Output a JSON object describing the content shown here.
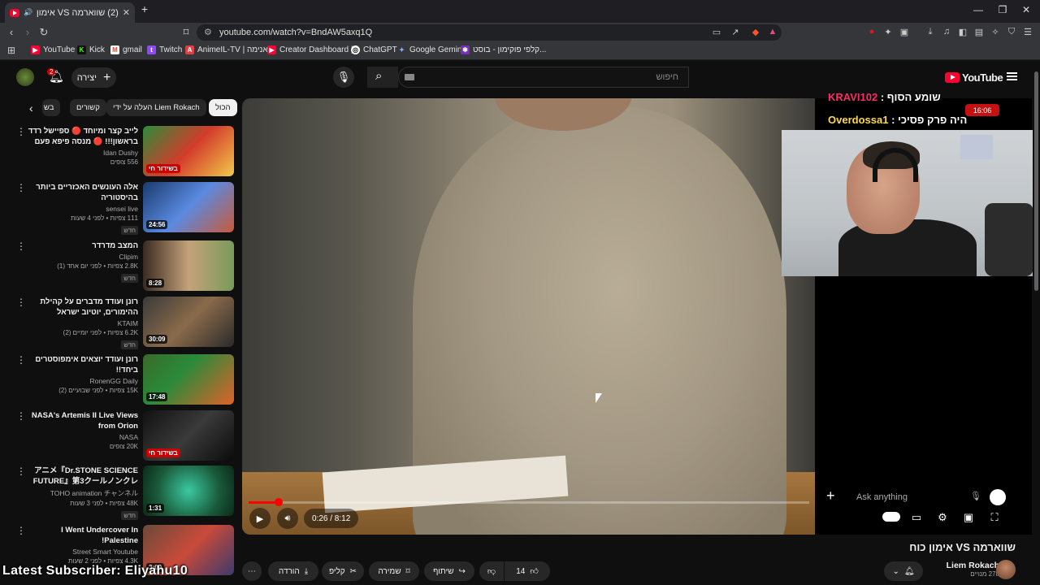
{
  "browser": {
    "tab_title": "(2) שווארמה VS אימון כוח - YouTube",
    "url": "youtube.com/watch?v=BndAW5axq1Q",
    "bookmarks": [
      {
        "label": "YouTube",
        "icon": "youtube-icon",
        "color": "#ff0033"
      },
      {
        "label": "Kick",
        "icon": "kick-icon",
        "color": "#53fc18"
      },
      {
        "label": "gmail",
        "icon": "gmail-icon",
        "color": "#ea4335"
      },
      {
        "label": "Twitch",
        "icon": "twitch-icon",
        "color": "#9146ff"
      },
      {
        "label": "AnimeIL-TV | אנימה...",
        "icon": "animeil-icon",
        "color": "#e04040"
      },
      {
        "label": "Creator Dashboard |...",
        "icon": "creator-dashboard-icon",
        "color": "#ff0033"
      },
      {
        "label": "ChatGPT",
        "icon": "chatgpt-icon",
        "color": "#cccccc"
      },
      {
        "label": "Google Gemini",
        "icon": "gemini-icon",
        "color": "#8ab4f8"
      },
      {
        "label": "קלפי פוקימון - בוסט...",
        "icon": "pokemon-icon",
        "color": "#7b2cbf"
      }
    ]
  },
  "youtube": {
    "search_placeholder": "חיפוש",
    "create_label": "יצירה",
    "notification_count": "2",
    "logo_text": "YouTube",
    "chips": [
      "הכול",
      "העלה על ידי Liem Rokach",
      "קשורים",
      "בש"
    ],
    "sidebar": [
      {
        "title": "לייב קצר ומיוחד 🔴 ספיישל רדד בראשון!!! 🔴 מנסה פיפא פעם ...",
        "channel": "Idan Dushy",
        "meta": "556 צופים",
        "badge": "בשידור חי",
        "live": true,
        "is_new": false
      },
      {
        "title": "אלה העונשים האכזריים ביותר בהיסטוריה",
        "channel": "sensei live",
        "meta": "111 צפיות • לפני 4 שעות",
        "badge": "24:56",
        "live": false,
        "is_new": true
      },
      {
        "title": "המצב מדרדר",
        "channel": "Clipim",
        "meta": "2.8K צפיות • לפני יום אחד (1)",
        "badge": "8:28",
        "live": false,
        "is_new": true
      },
      {
        "title": "רונן ועודד מדברים על קהילת ההימורים, יוטיוב ישראל וקהילת...",
        "channel": "KTAIM",
        "meta": "6.2K צפיות • לפני יומיים (2)",
        "badge": "30:09",
        "live": false,
        "is_new": true
      },
      {
        "title": "רונן ועודד יוצאים אימפוסטרים ביחד!!",
        "channel": "RonenGG Daily",
        "meta": "15K צפיות • לפני שבועיים (2)",
        "badge": "17:48",
        "live": false,
        "is_new": false
      },
      {
        "title": "NASA's Artemis II Live Views from Orion",
        "channel": "NASA",
        "meta": "20K צופים",
        "badge": "בשידור חי",
        "live": true,
        "is_new": false
      },
      {
        "title": "アニメ『Dr.STONE SCIENCE FUTURE』第3クールノンクレジ...",
        "channel": "TOHO animation チャンネル",
        "meta": "48K צפיות • לפני 3 שעות",
        "badge": "1:31",
        "live": false,
        "is_new": true
      },
      {
        "title": "I Went Undercover In Palestine!",
        "channel": "Street Smart Youtube",
        "meta": "4.3K צפיות • לפני 2 שעות",
        "badge": "3:09",
        "live": false,
        "is_new": true
      }
    ],
    "new_label": "חדש",
    "player": {
      "current_time": "0:26",
      "duration": "8:12",
      "time_display": "0:26 / 8:12",
      "progress_fraction": 0.053
    },
    "ask_placeholder": "Ask anything",
    "video_title": "שווארמה VS אימון כוח",
    "channel_name": "Liem Rokach",
    "subscriber_count": "278 מנויים",
    "actions": {
      "like_count": "14",
      "share_label": "שיתוף",
      "save_label": "שמירה",
      "clip_label": "קליפ",
      "download_label": "הורדה"
    }
  },
  "overlay": {
    "chat_lines": [
      {
        "user": "KRAVI102",
        "text": "שומע הסוף :",
        "user_color": "#ff2a6d"
      },
      {
        "user": "Overdossa1",
        "text": "היה פרק פסיכי :",
        "user_color": "#ffd84d"
      }
    ],
    "stream_timer": "16:06",
    "latest_subscriber": "Latest Subscriber: Eliyahu10"
  }
}
